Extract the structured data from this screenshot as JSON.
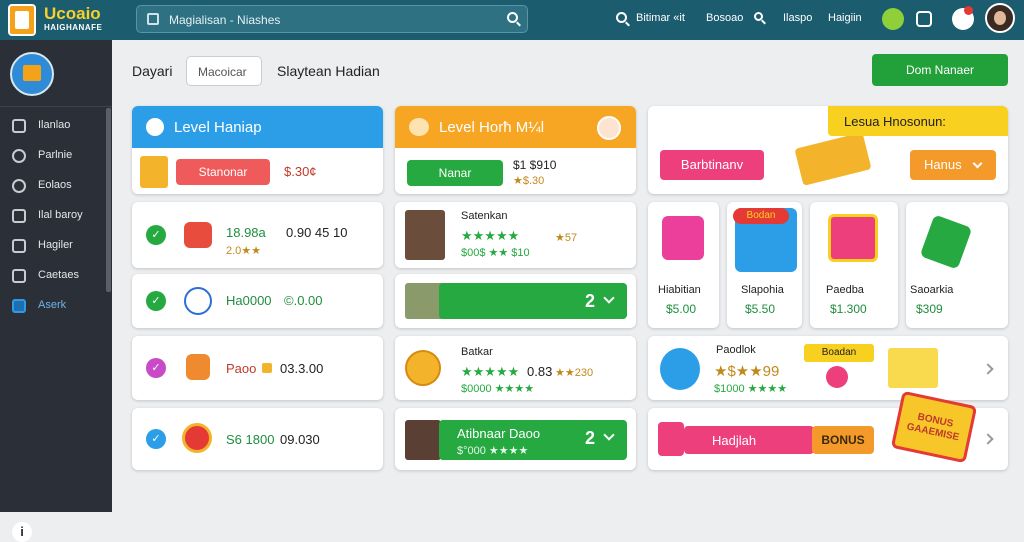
{
  "topbar": {
    "brand": "Ucoaio",
    "brand_sub": "HAIGHANAFE",
    "search_text": "Magialisan -   Niashes",
    "nav": [
      "Bitimar «it",
      "Bosoao",
      "Ilaspo",
      "Haigiin"
    ]
  },
  "sidebar": {
    "items": [
      {
        "label": "Ilanlao",
        "icon": "gauge-icon"
      },
      {
        "label": "Parlnie",
        "icon": "globe-icon"
      },
      {
        "label": "Eolaos",
        "icon": "settings-icon"
      },
      {
        "label": "Ilal baroy",
        "icon": "chart-icon"
      },
      {
        "label": "Hagiler",
        "icon": "folder-icon"
      },
      {
        "label": "Caetaes",
        "icon": "grid-icon"
      },
      {
        "label": "Aserk",
        "icon": "window-icon"
      }
    ]
  },
  "toolbar": {
    "label1": "Dayari",
    "input_value": "Macoicar",
    "label2": "Slaytean Hadian",
    "button": "Dom Nanaer"
  },
  "col1": {
    "header": "Level Haniap",
    "button": "Stanonar",
    "price": "$.30¢",
    "rows": [
      {
        "value": "18.98a",
        "sub": "2.0★★",
        "extra": "0.90 45 10"
      },
      {
        "value": "Ha0000",
        "extra": "©.0.00"
      },
      {
        "value": "Paoo",
        "extra": "03.3.00"
      },
      {
        "value": "S6 1800",
        "extra": "09.030"
      }
    ]
  },
  "col2": {
    "header": "Level Horħ M¼l",
    "button": "Nanar",
    "price": "$1 $910",
    "rating": "★$.30",
    "card1": {
      "name": "Satenkan",
      "stars": "★★★★★",
      "sub": "$00$ ★★ $10",
      "badge": "★57"
    },
    "card2": {
      "value": "2"
    },
    "card3": {
      "name": "Batkar",
      "stars": "★★★★★",
      "value": "0.83",
      "extra": "★★230",
      "sub": "$0000 ★★★★"
    },
    "card4": {
      "name": "Atibnaar Daoo",
      "sub": "$°000 ★★★★",
      "value": "2"
    }
  },
  "col3": {
    "banner_button": "Barbtinanv",
    "banner_tag": "Lesua Hnosonun:",
    "banner_dropdown": "Hanus",
    "items": [
      {
        "name": "Hiabitian",
        "price": "$5.00"
      },
      {
        "name": "Slapohia",
        "price": "$5.50",
        "badge": "Bodan"
      },
      {
        "name": "Paedba",
        "price": "$1.300"
      },
      {
        "name": "Saoarkia",
        "price": "$309"
      }
    ],
    "promo": {
      "name": "Paodlok",
      "stars": "★$★★99",
      "sub": "$1000 ★★★★",
      "tag": "Boadan"
    },
    "bottom": {
      "label": "Hadjlah",
      "bonus": "BONUS",
      "sticker": "BONUS GAAEMISE"
    }
  }
}
